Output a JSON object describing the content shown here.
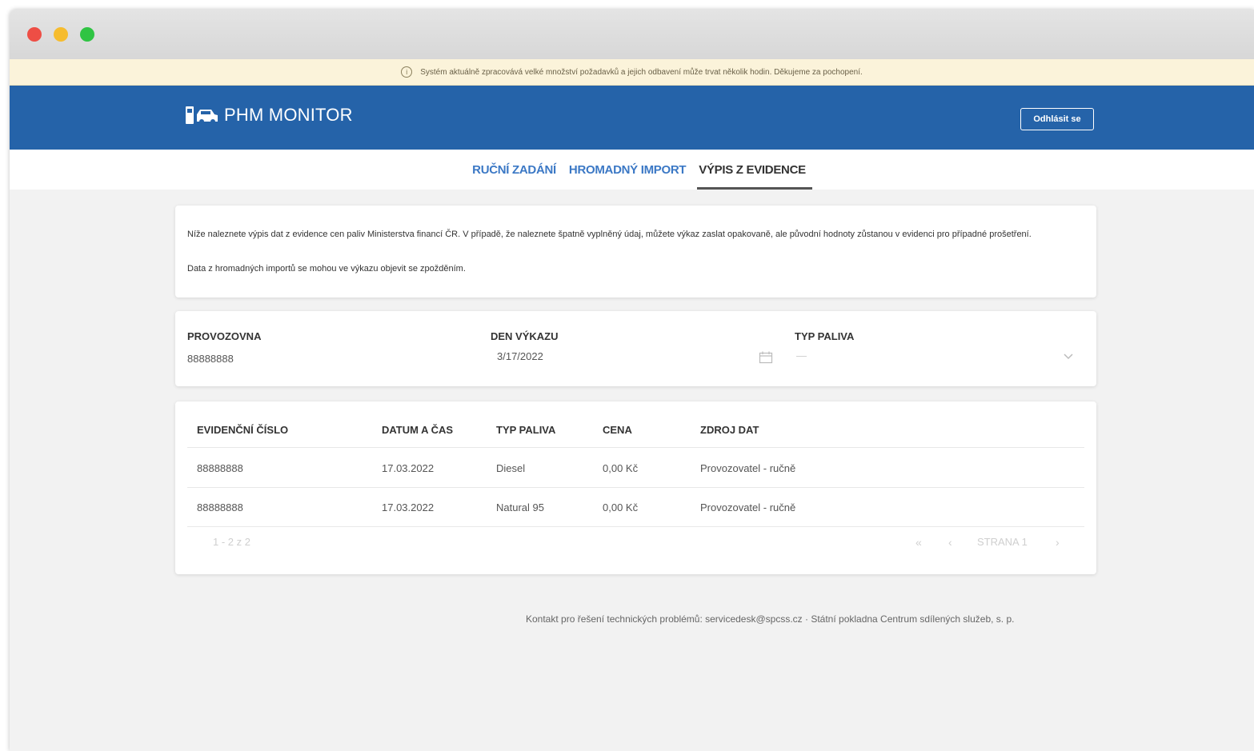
{
  "notice": {
    "text": "Systém aktuálně zpracovává velké množství požadavků a jejich odbavení může trvat několik hodin. Děkujeme za pochopení."
  },
  "header": {
    "logo_text": "PHM MONITOR",
    "logout_label": "Odhlásit se",
    "brand_color": "#2563a9"
  },
  "tabs": [
    {
      "label": "RUČNÍ ZADÁNÍ",
      "active": false
    },
    {
      "label": "HROMADNÝ IMPORT",
      "active": false
    },
    {
      "label": "VÝPIS Z EVIDENCE",
      "active": true
    }
  ],
  "intro": {
    "paragraph1": "Níže naleznete výpis dat z evidence cen paliv Ministerstva financí ČR. V případě, že naleznete špatně vyplněný údaj, můžete výkaz zaslat opakovaně, ale původní hodnoty zůstanou v evidenci pro případné prošetření.",
    "paragraph2": "Data z hromadných importů se mohou ve výkazu objevit se zpožděním."
  },
  "filters": {
    "provozovna": {
      "label": "PROVOZOVNA",
      "value": "88888888"
    },
    "den_vykazu": {
      "label": "DEN VÝKAZU",
      "value": "3/17/2022"
    },
    "typ_paliva": {
      "label": "TYP PALIVA",
      "value": "—"
    }
  },
  "table": {
    "columns": [
      "EVIDENČNÍ ČÍSLO",
      "DATUM A ČAS",
      "TYP PALIVA",
      "CENA",
      "ZDROJ DAT"
    ],
    "rows": [
      [
        "88888888",
        "17.03.2022",
        "Diesel",
        "0,00 Kč",
        "Provozovatel - ručně"
      ],
      [
        "88888888",
        "17.03.2022",
        "Natural 95",
        "0,00 Kč",
        "Provozovatel - ručně"
      ]
    ],
    "pagination": {
      "range": "1 - 2 z 2",
      "page_label": "STRANA 1"
    }
  },
  "footer": {
    "text": "Kontakt pro řešení technických problémů: servicedesk@spcss.cz · Státní pokladna Centrum sdílených služeb, s. p."
  }
}
